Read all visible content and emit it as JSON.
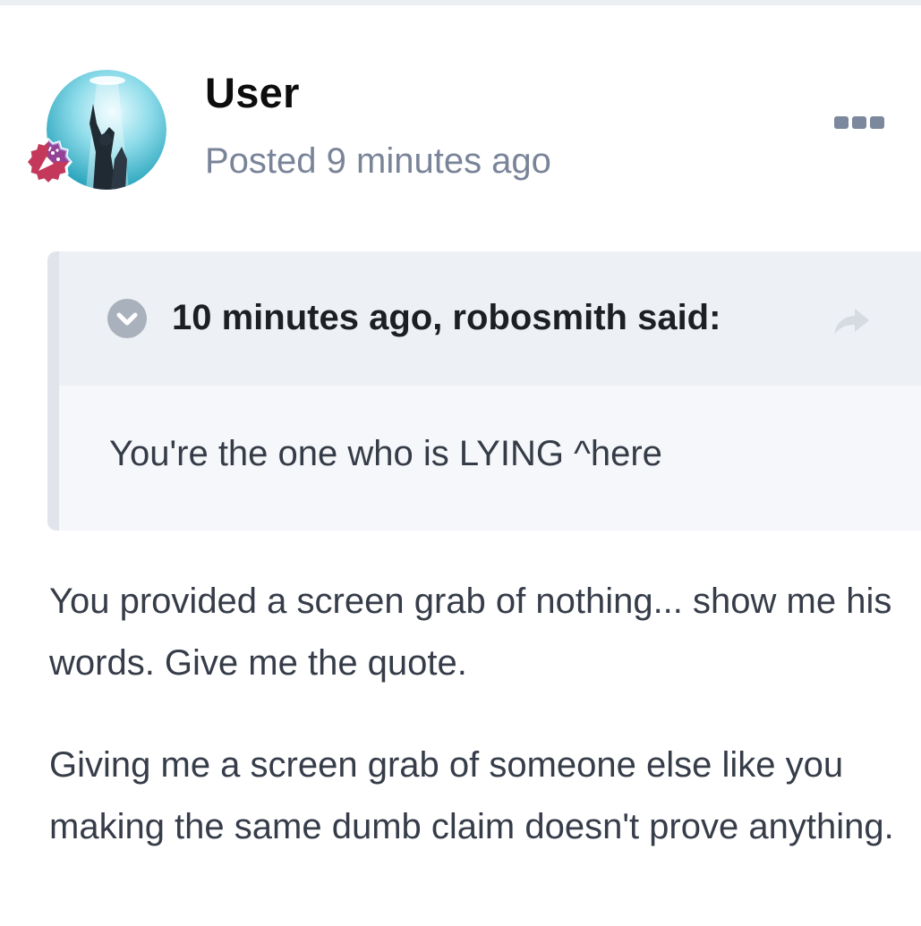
{
  "post": {
    "author": "User",
    "posted": "Posted 9 minutes ago",
    "avatar_icon": "astronaut-avatar",
    "badge_icon": "confetti-badge-icon",
    "menu_icon": "more-options-icon"
  },
  "quote": {
    "citation": "10 minutes ago, robosmith said:",
    "text": "You're the one who is LYING ^here",
    "toggle_icon": "chevron-down-icon",
    "share_icon": "share-arrow-icon"
  },
  "body": {
    "paragraphs": [
      "You provided a screen grab of nothing... show me his words. Give me the quote.",
      "Giving me a screen grab of someone else like you making the same dumb claim doesn't prove anything."
    ]
  },
  "colors": {
    "badge": "#c4395b",
    "username": "#0d0d0d",
    "meta": "#7a8499",
    "quote_bg": "#f5f7fa",
    "quote_head_bg": "#edf0f4"
  }
}
